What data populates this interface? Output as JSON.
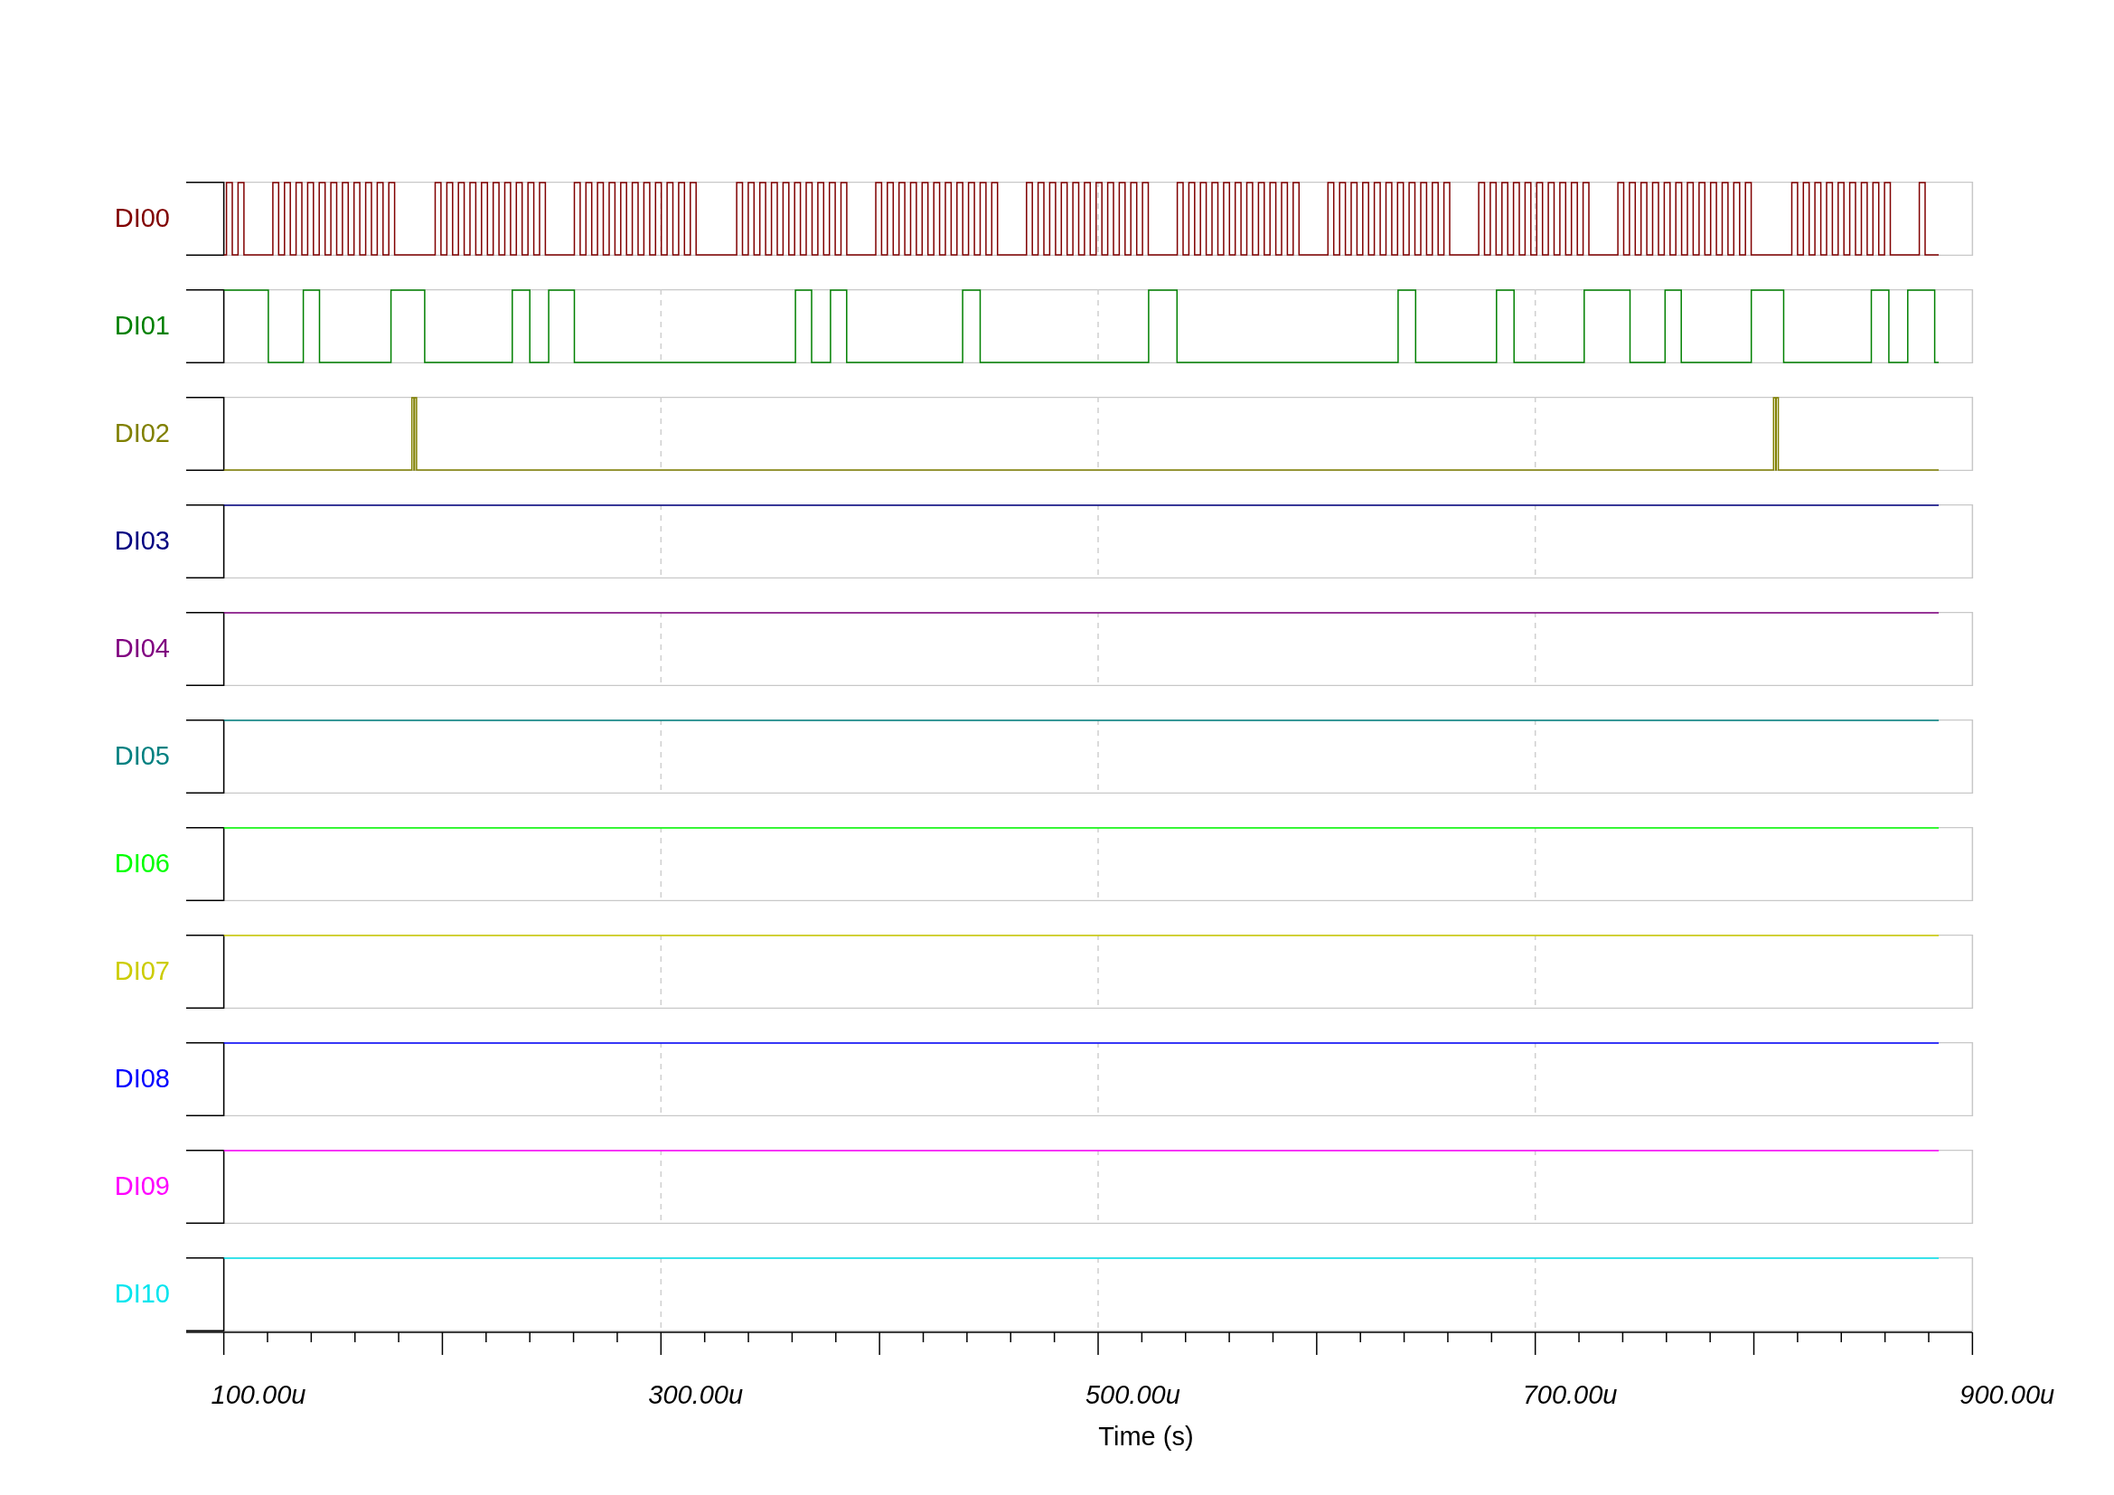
{
  "channels": [
    {
      "name": "DI00",
      "color": "#800000",
      "kind": "burst"
    },
    {
      "name": "DI01",
      "color": "#008000",
      "kind": "toggle"
    },
    {
      "name": "DI02",
      "color": "#808000",
      "kind": "glitch"
    },
    {
      "name": "DI03",
      "color": "#000080",
      "kind": "high"
    },
    {
      "name": "DI04",
      "color": "#800080",
      "kind": "high"
    },
    {
      "name": "DI05",
      "color": "#008080",
      "kind": "high"
    },
    {
      "name": "DI06",
      "color": "#00ff00",
      "kind": "high"
    },
    {
      "name": "DI07",
      "color": "#cccc00",
      "kind": "high"
    },
    {
      "name": "DI08",
      "color": "#0000ff",
      "kind": "high"
    },
    {
      "name": "DI09",
      "color": "#ff00ff",
      "kind": "high"
    },
    {
      "name": "DI10",
      "color": "#00e5ee",
      "kind": "high"
    }
  ],
  "time_axis": {
    "ticks": [
      "100.00u",
      "300.00u",
      "500.00u",
      "700.00u",
      "900.00u"
    ],
    "label": "Time (s)"
  }
}
